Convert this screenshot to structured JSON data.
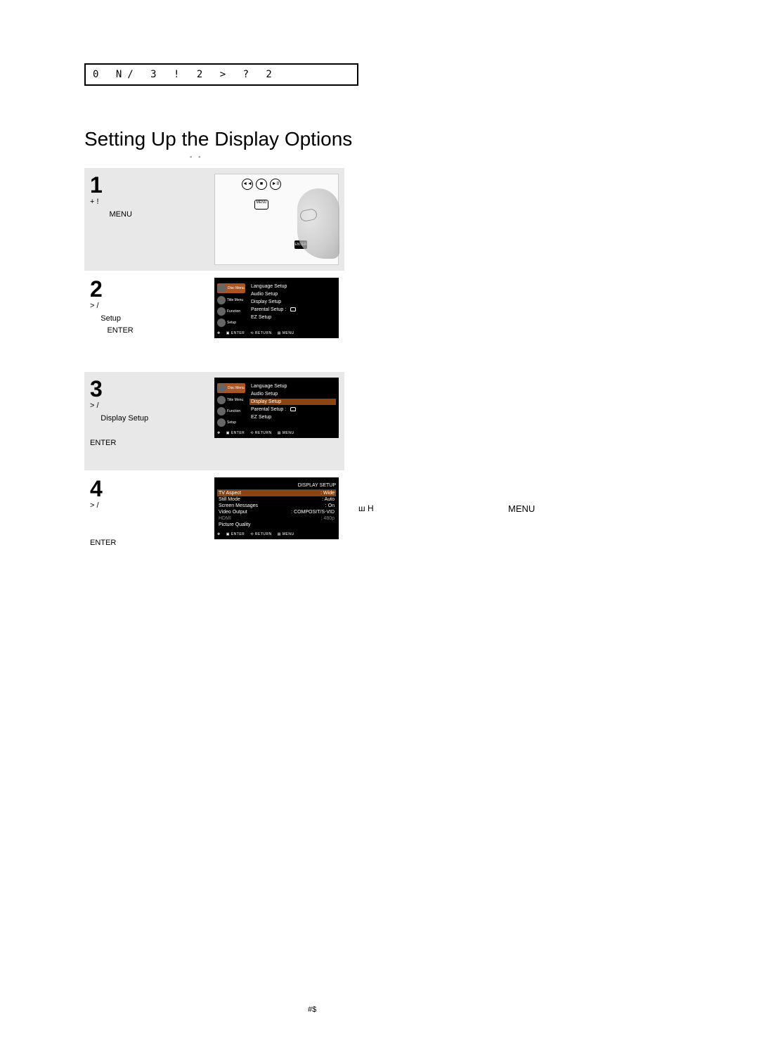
{
  "header_line": "0 N/  3     !   2 >  ?  2",
  "section_title": "Setting Up the Display Options",
  "subtitle": "-    -",
  "steps": [
    {
      "num": "1",
      "text_prefix": "+           !",
      "key": "MENU"
    },
    {
      "num": "2",
      "text_prefix": ">          /",
      "sub": "Setup",
      "key": "ENTER"
    },
    {
      "num": "3",
      "text_prefix": ">          /",
      "sub": "Display Setup",
      "key": "ENTER"
    },
    {
      "num": "4",
      "text_prefix": ">          /",
      "key": "ENTER"
    }
  ],
  "osd": {
    "tabs": [
      "Disc Menu",
      "Title Menu",
      "Function",
      "Setup"
    ],
    "menu_items": [
      "Language Setup",
      "Audio Setup",
      "Display Setup",
      "Parental Setup :",
      "EZ Setup"
    ],
    "footer": [
      "ENTER",
      "RETURN",
      "MENU"
    ],
    "display_header": "DISPLAY SETUP",
    "display_items": [
      {
        "label": "TV Aspect",
        "val": "Wide"
      },
      {
        "label": "Still Mode",
        "val": "Auto"
      },
      {
        "label": "Screen Messages",
        "val": "On"
      },
      {
        "label": "Video Output",
        "val": "COMPOSIT/S-VID"
      },
      {
        "label": "HDMI",
        "val": "480p"
      },
      {
        "label": "Picture Quality",
        "val": ""
      }
    ]
  },
  "side_e": "ш    H",
  "side_menu": "MENU",
  "page_num": "#$"
}
